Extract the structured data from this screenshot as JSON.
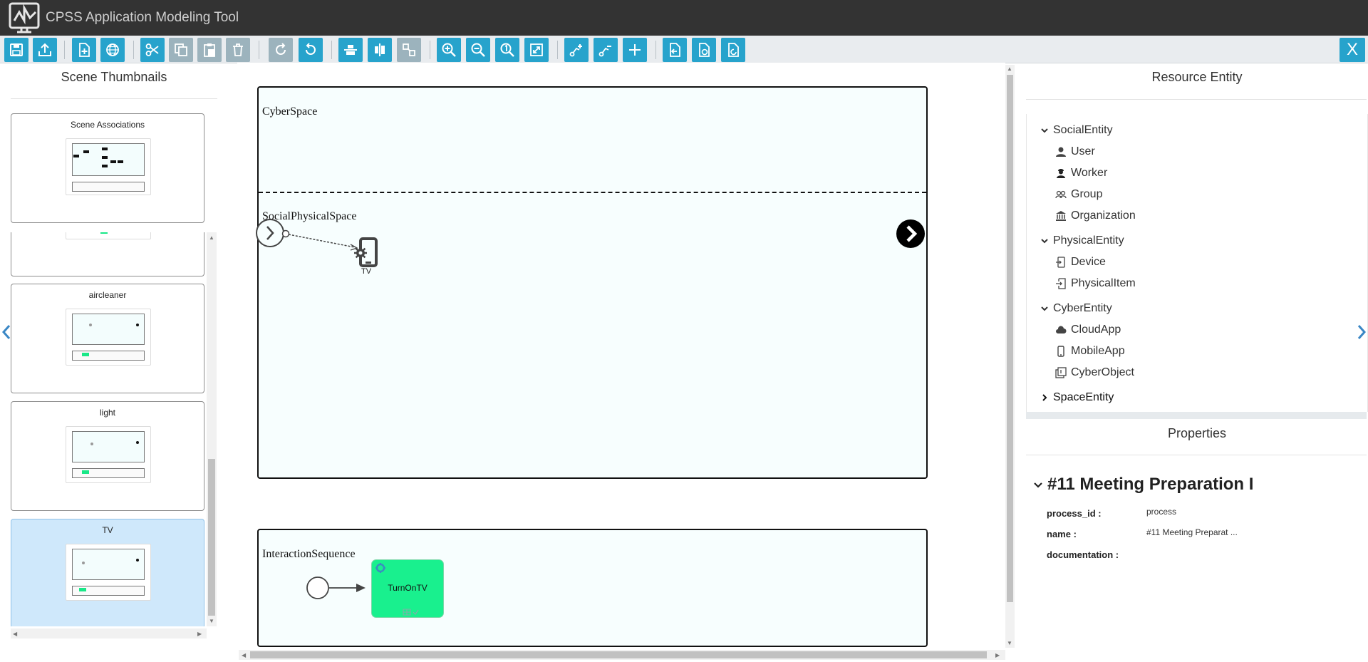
{
  "app": {
    "title": "CPSS Application Modeling Tool",
    "close_label": "X"
  },
  "left_panel": {
    "title": "Scene Thumbnails",
    "scenes": [
      {
        "label": "Scene Associations",
        "selected": false
      },
      {
        "label": "",
        "selected": false
      },
      {
        "label": "aircleaner",
        "selected": false
      },
      {
        "label": "light",
        "selected": false
      },
      {
        "label": "TV",
        "selected": true
      }
    ]
  },
  "canvas": {
    "lanes": {
      "cyber": "CyberSpace",
      "social_physical": "SocialPhysicalSpace",
      "interaction": "InteractionSequence"
    },
    "device_label": "TV",
    "task_label": "TurnOnTV"
  },
  "right_panel": {
    "resource_title": "Resource Entity",
    "tree": [
      {
        "label": "SocialEntity",
        "expanded": true,
        "children": [
          {
            "label": "User",
            "icon": "user-icon"
          },
          {
            "label": "Worker",
            "icon": "worker-icon"
          },
          {
            "label": "Group",
            "icon": "group-icon"
          },
          {
            "label": "Organization",
            "icon": "organization-icon"
          }
        ]
      },
      {
        "label": "PhysicalEntity",
        "expanded": true,
        "children": [
          {
            "label": "Device",
            "icon": "device-icon"
          },
          {
            "label": "PhysicalItem",
            "icon": "physical-item-icon"
          }
        ]
      },
      {
        "label": "CyberEntity",
        "expanded": true,
        "children": [
          {
            "label": "CloudApp",
            "icon": "cloud-icon"
          },
          {
            "label": "MobileApp",
            "icon": "mobile-icon"
          },
          {
            "label": "CyberObject",
            "icon": "cyber-object-icon"
          }
        ]
      },
      {
        "label": "SpaceEntity",
        "expanded": false,
        "children": []
      }
    ],
    "properties_title": "Properties",
    "properties": {
      "heading": "#11 Meeting Preparation I",
      "rows": [
        {
          "key": "process_id :",
          "value": "process"
        },
        {
          "key": "name :",
          "value": "#11 Meeting Preparat ..."
        },
        {
          "key": "documentation :",
          "value": ""
        }
      ]
    }
  },
  "colors": {
    "accent": "#27a3cc",
    "task_green": "#19f08e",
    "titlebar": "#333333",
    "selected_thumb": "#cfe8fb"
  }
}
